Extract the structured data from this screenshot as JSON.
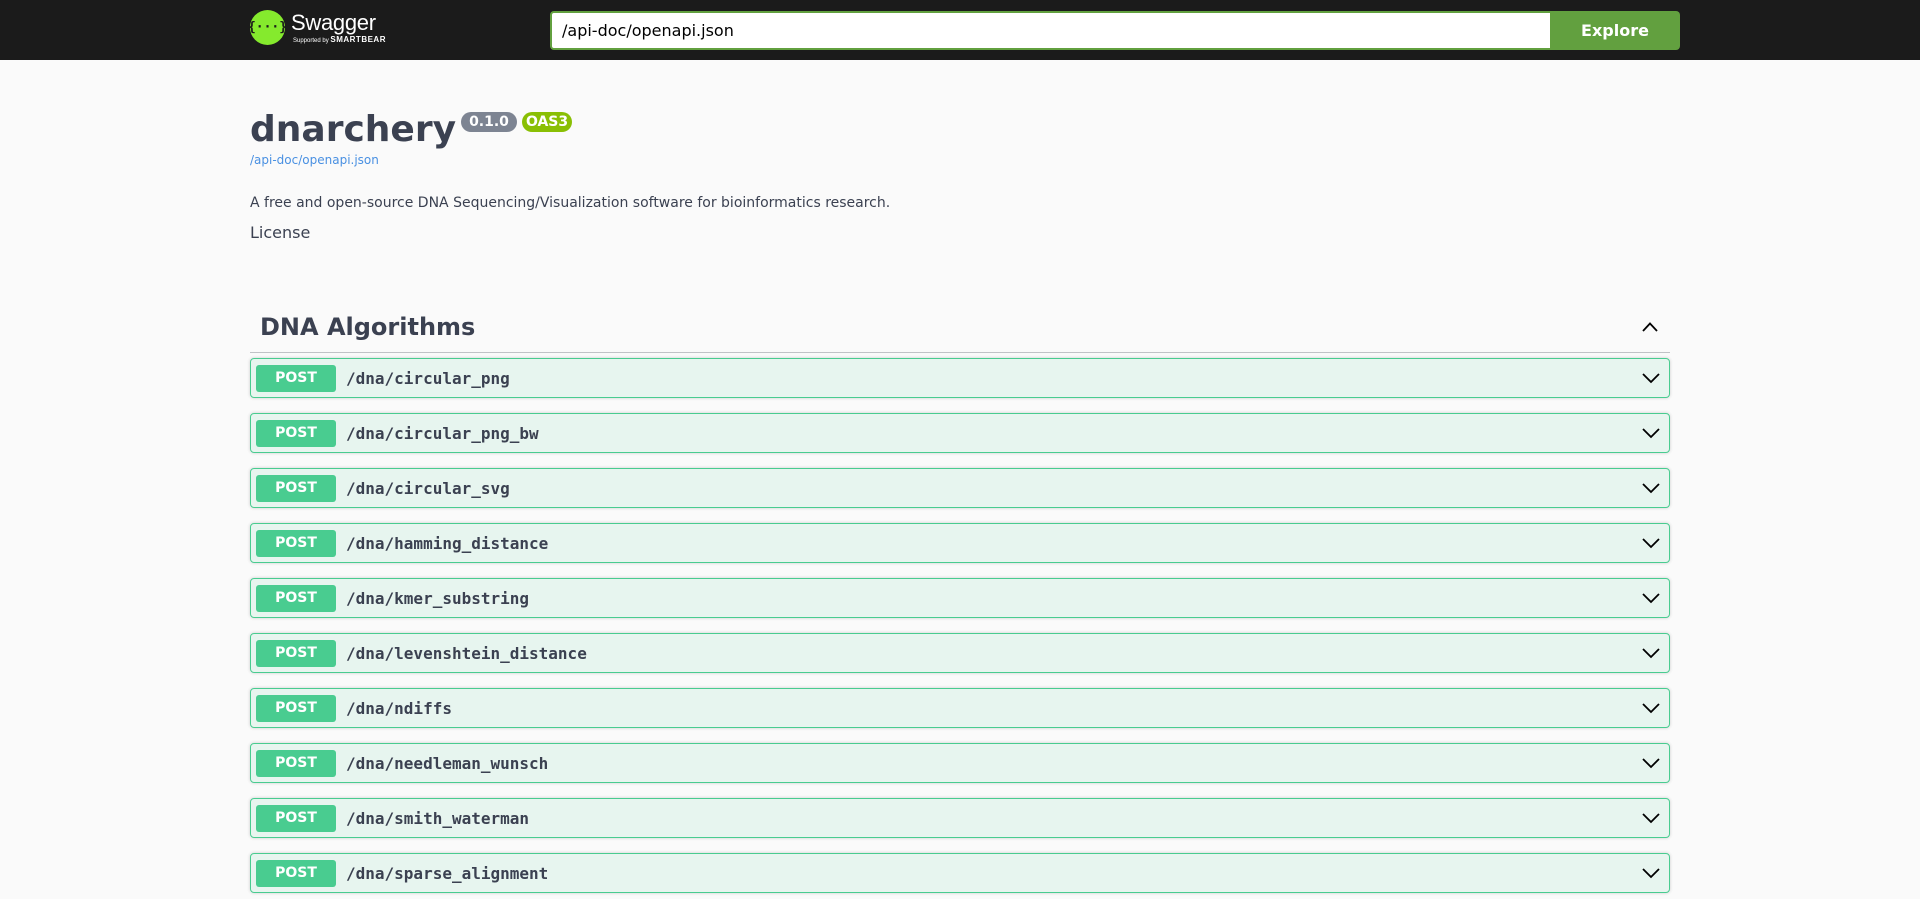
{
  "topbar": {
    "logo_name": "Swagger",
    "logo_supported_by": "Supported by",
    "logo_brand": "SMARTBEAR",
    "url_value": "/api-doc/openapi.json",
    "explore_label": "Explore"
  },
  "info": {
    "title": "dnarchery",
    "version": "0.1.0",
    "oas_badge": "OAS3",
    "spec_link": "/api-doc/openapi.json",
    "description": "A free and open-source DNA Sequencing/Visualization software for bioinformatics research.",
    "license": "License"
  },
  "tag": {
    "name": "DNA Algorithms",
    "operations": [
      {
        "method": "POST",
        "path": "/dna/circular_png"
      },
      {
        "method": "POST",
        "path": "/dna/circular_png_bw"
      },
      {
        "method": "POST",
        "path": "/dna/circular_svg"
      },
      {
        "method": "POST",
        "path": "/dna/hamming_distance"
      },
      {
        "method": "POST",
        "path": "/dna/kmer_substring"
      },
      {
        "method": "POST",
        "path": "/dna/levenshtein_distance"
      },
      {
        "method": "POST",
        "path": "/dna/ndiffs"
      },
      {
        "method": "POST",
        "path": "/dna/needleman_wunsch"
      },
      {
        "method": "POST",
        "path": "/dna/smith_waterman"
      },
      {
        "method": "POST",
        "path": "/dna/sparse_alignment"
      }
    ]
  },
  "colors": {
    "topbar_bg": "#1b1b1b",
    "accent_green": "#62a03f",
    "post_green": "#49cc90",
    "version_badge": "#7d8492",
    "oas_badge": "#89bf04",
    "link_blue": "#4990e2"
  }
}
